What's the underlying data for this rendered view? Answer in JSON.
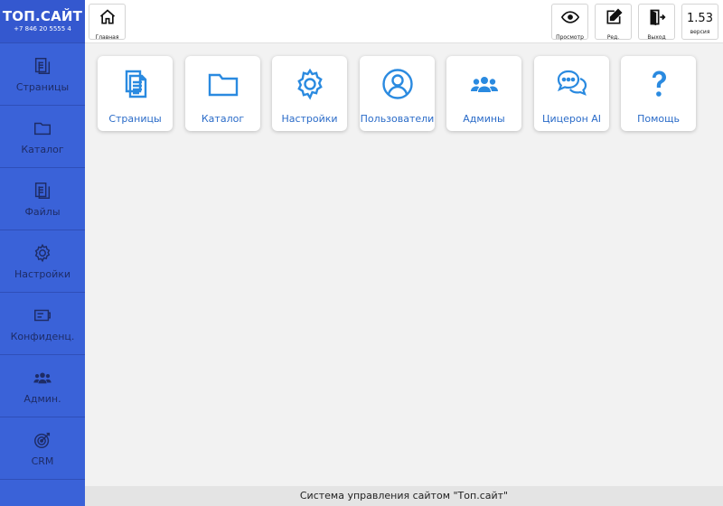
{
  "brand": {
    "title": "ТОП.САЙТ",
    "phone": "+7 846 20 5555 4"
  },
  "sidebar": {
    "items": [
      {
        "label": "Страницы",
        "icon": "pages-icon"
      },
      {
        "label": "Каталог",
        "icon": "folder-icon"
      },
      {
        "label": "Файлы",
        "icon": "files-icon"
      },
      {
        "label": "Настройки",
        "icon": "gear-icon"
      },
      {
        "label": "Конфиденц.",
        "icon": "privacy-icon"
      },
      {
        "label": "Админ.",
        "icon": "users-icon"
      },
      {
        "label": "CRM",
        "icon": "target-icon"
      }
    ]
  },
  "topbar": {
    "home_label": "Главная",
    "preview_label": "Просмотр",
    "edit_label": "Ред.",
    "exit_label": "Выход",
    "version_value": "1.53",
    "version_label": "версия"
  },
  "tiles": [
    {
      "label": "Страницы",
      "icon": "pages-icon"
    },
    {
      "label": "Каталог",
      "icon": "folder-icon"
    },
    {
      "label": "Настройки",
      "icon": "gear-icon"
    },
    {
      "label": "Пользователи",
      "icon": "user-icon"
    },
    {
      "label": "Админы",
      "icon": "users-icon"
    },
    {
      "label": "Цицерон AI",
      "icon": "chat-icon"
    },
    {
      "label": "Помощь",
      "icon": "help-icon"
    }
  ],
  "footer": {
    "text": "Система управления сайтом \"Топ.сайт\""
  },
  "colors": {
    "sidebar": "#3a62d8",
    "accent": "#2a8ae0",
    "background": "#f2f2f2"
  }
}
